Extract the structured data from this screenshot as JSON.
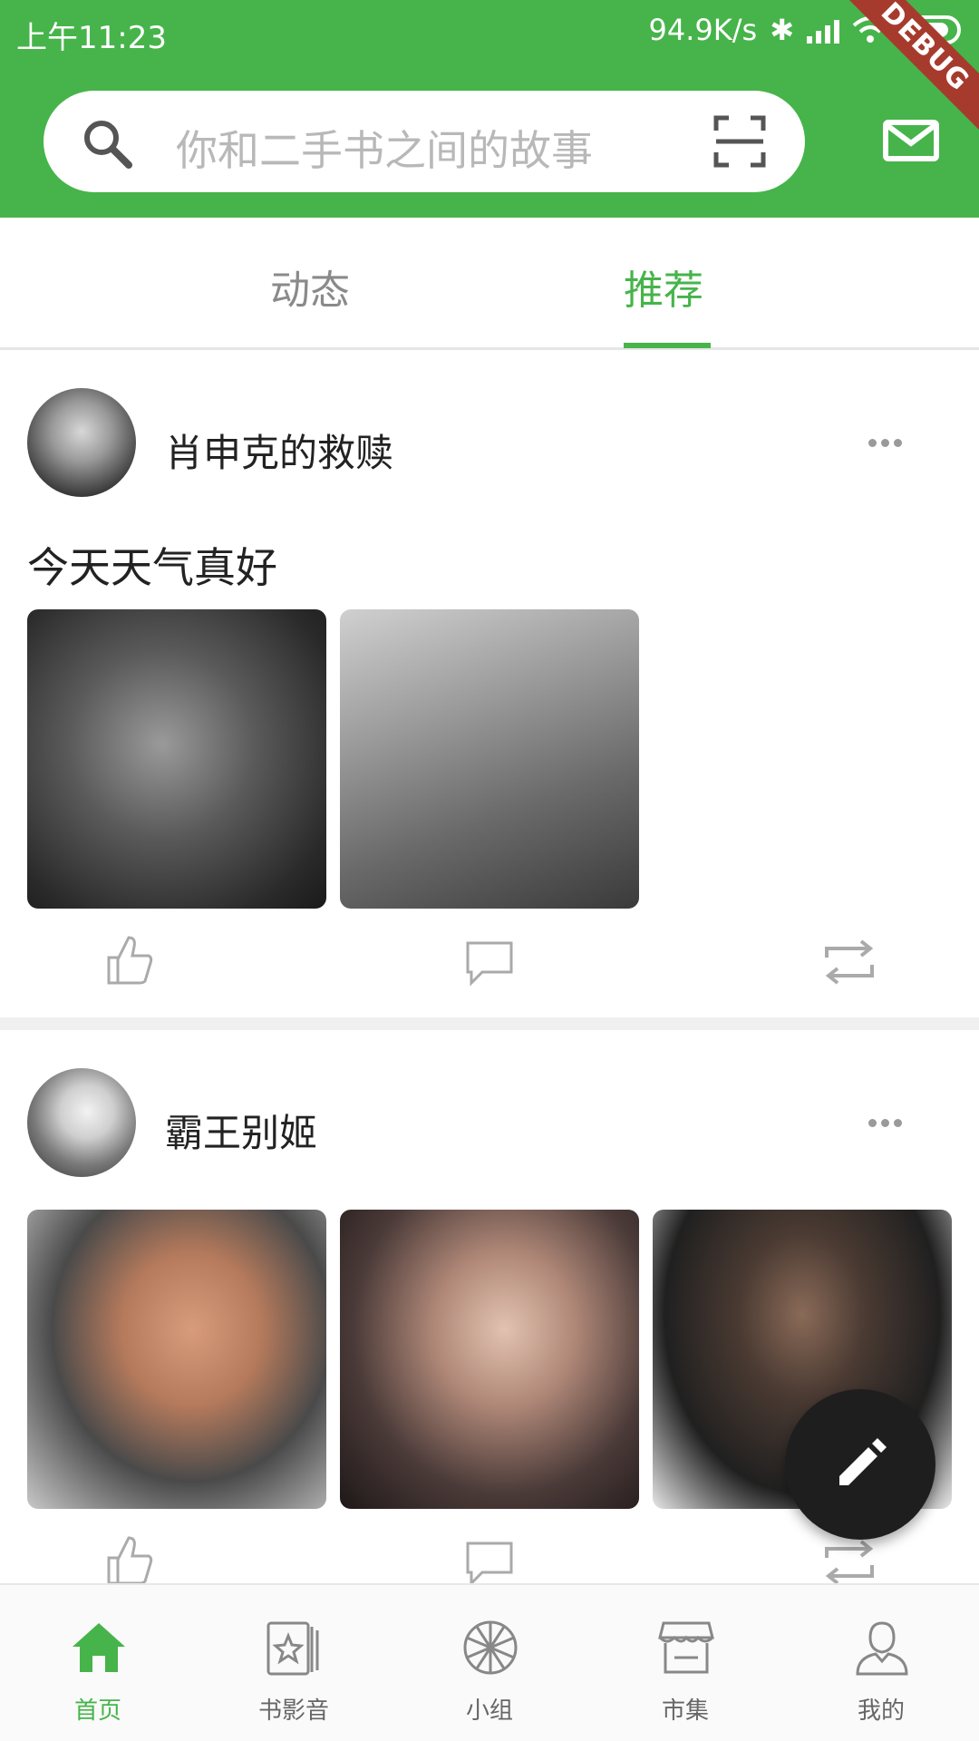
{
  "status_bar": {
    "time": "上午11:23",
    "speed": "94.9K/s",
    "debug_label": "DEBUG"
  },
  "search": {
    "placeholder": "你和二手书之间的故事"
  },
  "tabs": [
    {
      "label": "动态",
      "active": false
    },
    {
      "label": "推荐",
      "active": true
    }
  ],
  "posts": [
    {
      "user": "肖申克的救赎",
      "text": "今天天气真好",
      "photo_count": 2
    },
    {
      "user": "霸王别姬",
      "text": "",
      "photo_count": 3
    }
  ],
  "bottom_nav": [
    {
      "label": "首页",
      "icon": "home-icon",
      "active": true
    },
    {
      "label": "书影音",
      "icon": "book-film-icon",
      "active": false
    },
    {
      "label": "小组",
      "icon": "group-icon",
      "active": false
    },
    {
      "label": "市集",
      "icon": "market-icon",
      "active": false
    },
    {
      "label": "我的",
      "icon": "profile-icon",
      "active": false
    }
  ],
  "colors": {
    "brand": "#46b44a",
    "fab": "#1e1e1e",
    "debug_ribbon": "#a63b2d"
  }
}
